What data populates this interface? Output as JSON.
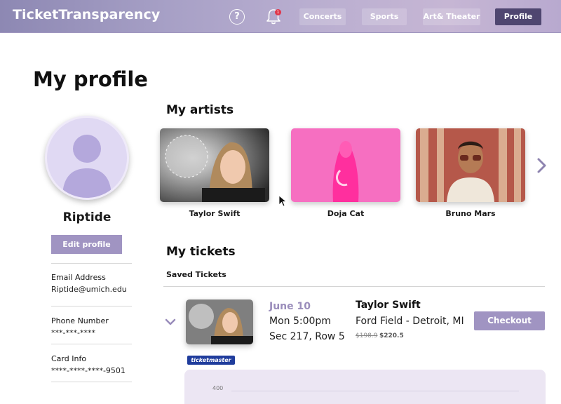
{
  "header": {
    "brand": "TicketTransparency",
    "help_glyph": "?",
    "notification_count": "1",
    "nav": [
      "Concerts",
      "Sports",
      "Art& Theater",
      "Profile"
    ],
    "active_nav": "Profile"
  },
  "profile": {
    "page_title": "My profile",
    "username": "Riptide",
    "edit_label": "Edit profile",
    "email_label": "Email Address",
    "email_value": "Riptide@umich.edu",
    "phone_label": "Phone Number",
    "phone_value": "***-***-****",
    "card_label": "Card Info",
    "card_value": "****-****-****-9501"
  },
  "artists": {
    "title": "My artists",
    "items": [
      "Taylor Swift",
      "Doja Cat",
      "Bruno Mars"
    ]
  },
  "tickets": {
    "title": "My tickets",
    "subtitle": "Saved Tickets",
    "item": {
      "date": "June 10",
      "time": "Mon 5:00pm",
      "seat": "Sec 217, Row 5",
      "artist": "Taylor Swift",
      "venue": "Ford Field - Detroit, MI",
      "old_price": "$198.9",
      "new_price": "$220.5",
      "checkout_label": "Checkout",
      "vendor": "ticketmaster"
    },
    "chart_tick": "400"
  },
  "colors": {
    "accent": "#a094c2",
    "header_dark": "#4f4670",
    "date_color": "#9a8dbb"
  }
}
